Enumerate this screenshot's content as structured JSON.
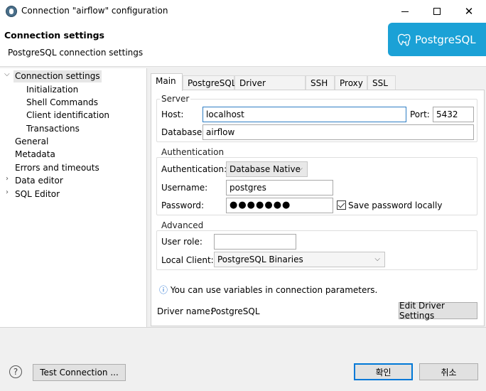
{
  "window": {
    "title": "Connection \"airflow\" configuration"
  },
  "header": {
    "title": "Connection settings",
    "subtitle": "PostgreSQL connection settings",
    "logo_text": "PostgreSQL"
  },
  "tree": {
    "items": [
      {
        "label": "Connection settings"
      },
      {
        "label": "Initialization"
      },
      {
        "label": "Shell Commands"
      },
      {
        "label": "Client identification"
      },
      {
        "label": "Transactions"
      },
      {
        "label": "General"
      },
      {
        "label": "Metadata"
      },
      {
        "label": "Errors and timeouts"
      },
      {
        "label": "Data editor"
      },
      {
        "label": "SQL Editor"
      }
    ]
  },
  "tabs": [
    {
      "label": "Main"
    },
    {
      "label": "PostgreSQL"
    },
    {
      "label": "Driver properties"
    },
    {
      "label": "SSH"
    },
    {
      "label": "Proxy"
    },
    {
      "label": "SSL"
    }
  ],
  "server": {
    "group_label": "Server",
    "host_label": "Host:",
    "host_value": "localhost",
    "port_label": "Port:",
    "port_value": "5432",
    "database_label": "Database:",
    "database_value": "airflow"
  },
  "auth": {
    "group_label": "Authentication",
    "auth_label": "Authentication:",
    "auth_value": "Database Native",
    "username_label": "Username:",
    "username_value": "postgres",
    "password_label": "Password:",
    "password_value": "●●●●●●●",
    "save_password_label": "Save password locally"
  },
  "advanced": {
    "group_label": "Advanced",
    "user_role_label": "User role:",
    "user_role_value": "",
    "local_client_label": "Local Client:",
    "local_client_value": "PostgreSQL Binaries"
  },
  "info": {
    "text": "You can use variables in connection parameters."
  },
  "driver": {
    "label": "Driver name:",
    "value": "PostgreSQL",
    "edit_button": "Edit Driver Settings"
  },
  "footer": {
    "test_button": "Test Connection ...",
    "ok_button": "확인",
    "cancel_button": "취소"
  },
  "colors": {
    "accent": "#0078d7",
    "logo_bg": "#1ba1d6"
  }
}
